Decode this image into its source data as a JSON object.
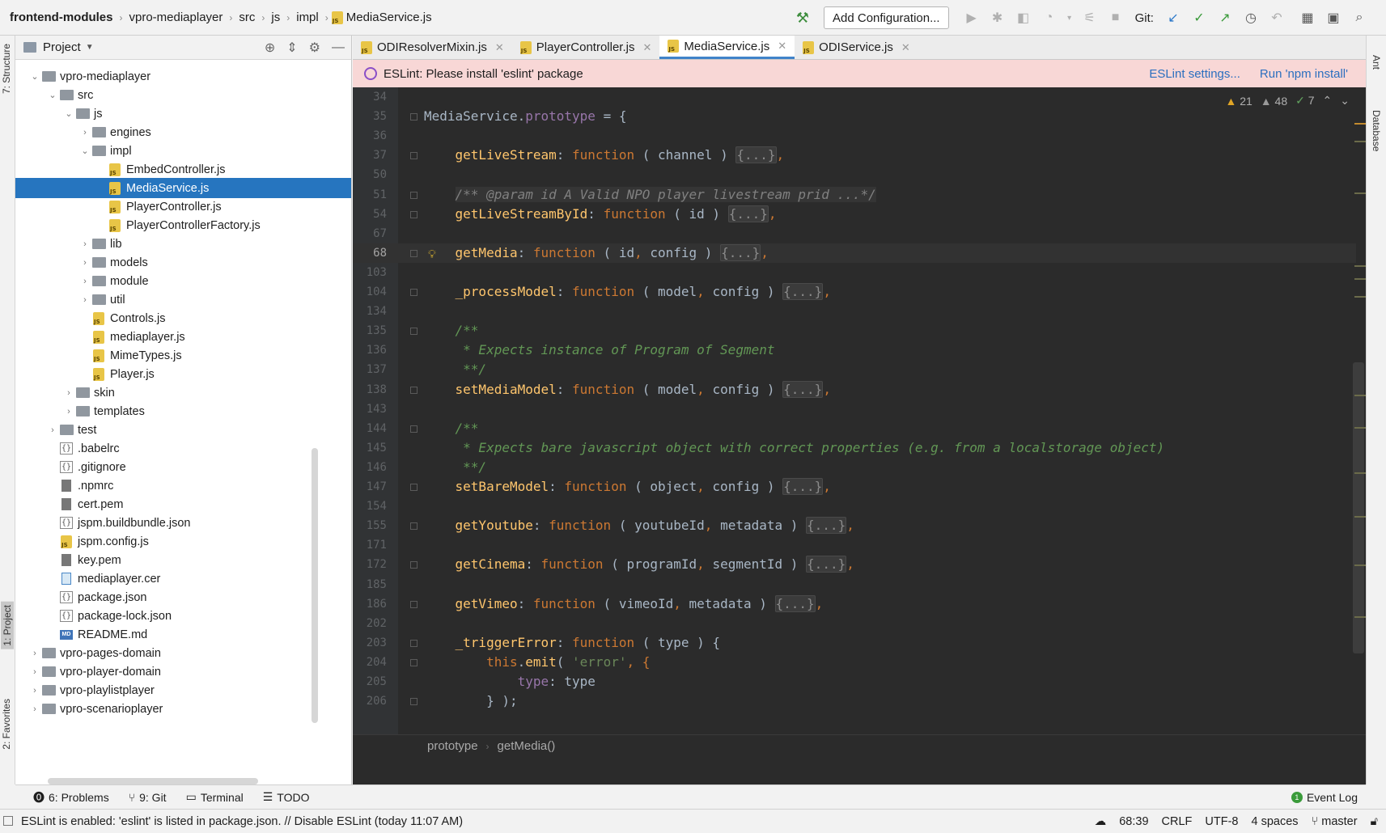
{
  "navbar": {
    "breadcrumbs": [
      "frontend-modules",
      "vpro-mediaplayer",
      "src",
      "js",
      "impl",
      "MediaService.js"
    ],
    "add_configuration": "Add Configuration...",
    "git_label": "Git:"
  },
  "left_stripe": {
    "structure": "7: Structure",
    "project": "1: Project",
    "favorites": "2: Favorites"
  },
  "right_stripe": {
    "ant": "Ant",
    "database": "Database"
  },
  "project_panel": {
    "title": "Project",
    "tree": [
      {
        "label": "vpro-mediaplayer",
        "kind": "folder",
        "arrow": "v"
      },
      {
        "label": "src",
        "kind": "folder",
        "arrow": "v"
      },
      {
        "label": "js",
        "kind": "folder",
        "arrow": "v"
      },
      {
        "label": "engines",
        "kind": "folder",
        "arrow": ">"
      },
      {
        "label": "impl",
        "kind": "folder",
        "arrow": "v"
      },
      {
        "label": "EmbedController.js",
        "kind": "js"
      },
      {
        "label": "MediaService.js",
        "kind": "js"
      },
      {
        "label": "PlayerController.js",
        "kind": "js"
      },
      {
        "label": "PlayerControllerFactory.js",
        "kind": "js"
      },
      {
        "label": "lib",
        "kind": "folder",
        "arrow": ">"
      },
      {
        "label": "models",
        "kind": "folder",
        "arrow": ">"
      },
      {
        "label": "module",
        "kind": "folder",
        "arrow": ">"
      },
      {
        "label": "util",
        "kind": "folder",
        "arrow": ">"
      },
      {
        "label": "Controls.js",
        "kind": "js"
      },
      {
        "label": "mediaplayer.js",
        "kind": "js"
      },
      {
        "label": "MimeTypes.js",
        "kind": "js"
      },
      {
        "label": "Player.js",
        "kind": "js"
      },
      {
        "label": "skin",
        "kind": "folder",
        "arrow": ">"
      },
      {
        "label": "templates",
        "kind": "folder",
        "arrow": ">"
      },
      {
        "label": "test",
        "kind": "folder",
        "arrow": ">"
      },
      {
        "label": ".babelrc",
        "kind": "json"
      },
      {
        "label": ".gitignore",
        "kind": "json"
      },
      {
        "label": ".npmrc",
        "kind": "text"
      },
      {
        "label": "cert.pem",
        "kind": "text"
      },
      {
        "label": "jspm.buildbundle.json",
        "kind": "json"
      },
      {
        "label": "jspm.config.js",
        "kind": "js"
      },
      {
        "label": "key.pem",
        "kind": "text"
      },
      {
        "label": "mediaplayer.cer",
        "kind": "cert"
      },
      {
        "label": "package.json",
        "kind": "json"
      },
      {
        "label": "package-lock.json",
        "kind": "json"
      },
      {
        "label": "README.md",
        "kind": "md"
      },
      {
        "label": "vpro-pages-domain",
        "kind": "folder",
        "arrow": ">"
      },
      {
        "label": "vpro-player-domain",
        "kind": "folder",
        "arrow": ">"
      },
      {
        "label": "vpro-playlistplayer",
        "kind": "folder",
        "arrow": ">"
      },
      {
        "label": "vpro-scenarioplayer",
        "kind": "folder",
        "arrow": ">"
      }
    ]
  },
  "editor": {
    "tabs": [
      {
        "label": "ODIResolverMixin.js",
        "active": false
      },
      {
        "label": "PlayerController.js",
        "active": false
      },
      {
        "label": "MediaService.js",
        "active": true
      },
      {
        "label": "ODIService.js",
        "active": false
      }
    ],
    "notice": {
      "message": "ESLint: Please install 'eslint' package",
      "settings_link": "ESLint settings...",
      "install_link": "Run 'npm install'"
    },
    "inspections": {
      "warnings": "21",
      "weak_warnings": "48",
      "ok": "7"
    },
    "line_numbers": [
      "34",
      "35",
      "36",
      "37",
      "50",
      "51",
      "54",
      "67",
      "68",
      "103",
      "104",
      "134",
      "135",
      "136",
      "137",
      "138",
      "143",
      "144",
      "145",
      "146",
      "147",
      "154",
      "155",
      "171",
      "172",
      "185",
      "186",
      "202",
      "203",
      "204",
      "205",
      "206"
    ],
    "code": {
      "l35": {
        "obj": "MediaService",
        "prop": "prototype",
        "rest": " = {"
      },
      "l37": {
        "name": "getLiveStream",
        "params": "channel"
      },
      "l51": {
        "doc": "/** @param id A Valid NPO player livestream prid ...*/"
      },
      "l54": {
        "name": "getLiveStreamById",
        "params": "id"
      },
      "l68": {
        "name": "getMedia",
        "params": "id, config"
      },
      "l104": {
        "name": "_processModel",
        "params": "model, config"
      },
      "l135": "/**",
      "l136": " * Expects instance of Program of Segment",
      "l137": " **/",
      "l138": {
        "name": "setMediaModel",
        "params": "model, config"
      },
      "l144": "/**",
      "l145": " * Expects bare javascript object with correct properties (e.g. from a localstorage object)",
      "l146": " **/",
      "l147": {
        "name": "setBareModel",
        "params": "object, config"
      },
      "l155": {
        "name": "getYoutube",
        "params": "youtubeId, metadata"
      },
      "l172": {
        "name": "getCinema",
        "params": "programId, segmentId"
      },
      "l186": {
        "name": "getVimeo",
        "params": "vimeoId, metadata"
      },
      "l203": {
        "name": "_triggerError",
        "params": "type"
      },
      "l204": {
        "this_kw": "this",
        "method": "emit",
        "str": "'error'"
      },
      "l205": {
        "prop": "type",
        "val": "type"
      },
      "l206": "} );",
      "kw_function": "function",
      "folded": "{...}"
    },
    "breadcrumb": [
      "prototype",
      "getMedia()"
    ]
  },
  "tool_windows": {
    "problems": "6: Problems",
    "git": "9: Git",
    "terminal": "Terminal",
    "todo": "TODO",
    "event_log": "Event Log"
  },
  "status_bar": {
    "message": "ESLint is enabled: 'eslint' is listed in package.json. // Disable ESLint (today 11:07 AM)",
    "position": "68:39",
    "line_sep": "CRLF",
    "encoding": "UTF-8",
    "indent": "4 spaces",
    "branch": "master"
  }
}
